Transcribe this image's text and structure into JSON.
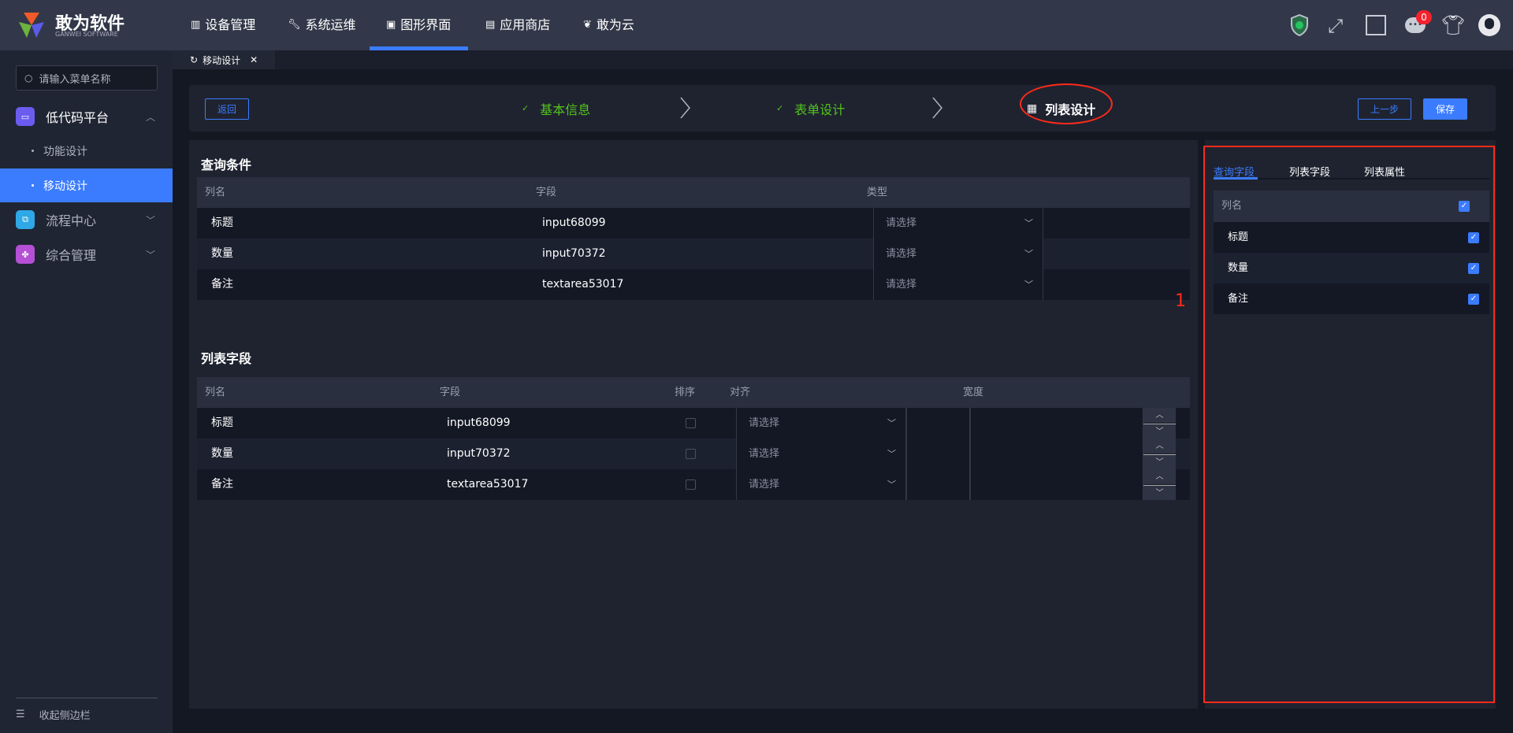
{
  "brand": {
    "name": "敢为软件",
    "sub": "GANWEI SOFTWARE"
  },
  "nav": [
    {
      "label": "设备管理"
    },
    {
      "label": "系统运维"
    },
    {
      "label": "图形界面"
    },
    {
      "label": "应用商店"
    },
    {
      "label": "敢为云"
    }
  ],
  "header": {
    "badge_count": "0"
  },
  "sidebar": {
    "search_placeholder": "请输入菜单名称",
    "groups": [
      {
        "label": "低代码平台",
        "children": [
          {
            "label": "功能设计"
          },
          {
            "label": "移动设计"
          }
        ]
      },
      {
        "label": "流程中心"
      },
      {
        "label": "综合管理"
      }
    ],
    "collapse_label": "收起侧边栏"
  },
  "tabs": [
    {
      "label": "移动设计"
    }
  ],
  "steps": {
    "back": "返回",
    "items": [
      {
        "label": "基本信息"
      },
      {
        "label": "表单设计"
      },
      {
        "label": "列表设计"
      }
    ],
    "prev": "上一步",
    "save": "保存"
  },
  "query": {
    "title": "查询条件",
    "headers": [
      "列名",
      "字段",
      "类型"
    ],
    "rows": [
      {
        "name": "标题",
        "field": "input68099",
        "type": "请选择"
      },
      {
        "name": "数量",
        "field": "input70372",
        "type": "请选择"
      },
      {
        "name": "备注",
        "field": "textarea53017",
        "type": "请选择"
      }
    ]
  },
  "list": {
    "title": "列表字段",
    "headers": [
      "列名",
      "字段",
      "排序",
      "对齐",
      "宽度"
    ],
    "rows": [
      {
        "name": "标题",
        "field": "input68099",
        "align": "请选择"
      },
      {
        "name": "数量",
        "field": "input70372",
        "align": "请选择"
      },
      {
        "name": "备注",
        "field": "textarea53017",
        "align": "请选择"
      }
    ]
  },
  "right": {
    "tabs": [
      "查询字段",
      "列表字段",
      "列表属性"
    ],
    "header": "列名",
    "rows": [
      "标题",
      "数量",
      "备注"
    ]
  },
  "annotation": "1",
  "colors": {
    "accent": "#3b7cff",
    "done": "#52c41a",
    "annotation": "#ff2a1a"
  }
}
